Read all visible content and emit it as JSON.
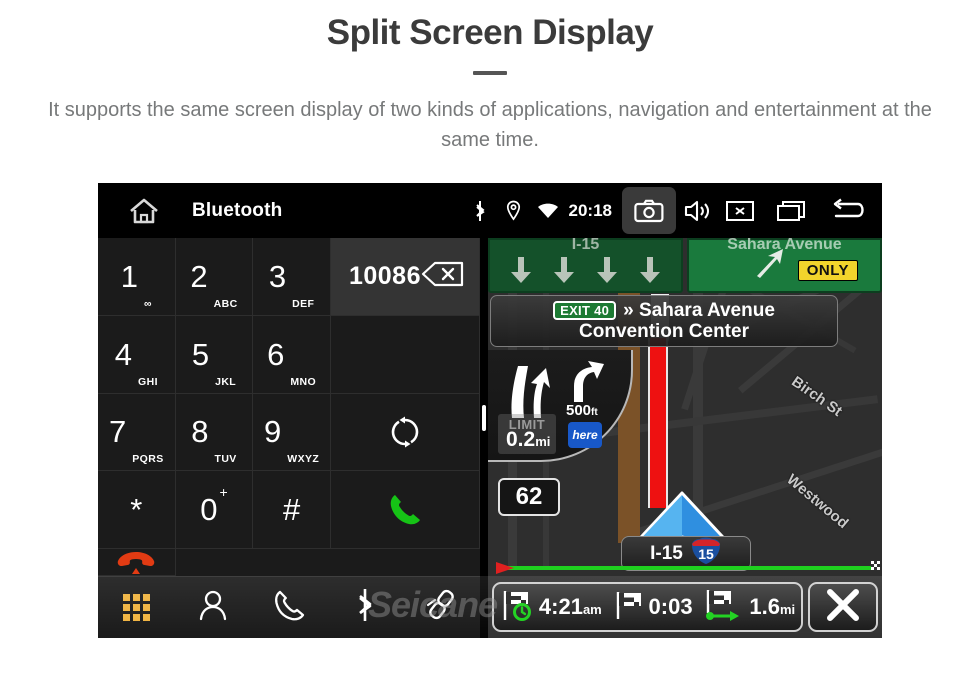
{
  "page": {
    "title": "Split Screen Display",
    "description": "It supports the same screen display of two kinds of applications, navigation and entertainment at the same time.",
    "watermark": "Seicane"
  },
  "statusbar": {
    "home_icon": "home-icon",
    "title": "Bluetooth",
    "bluetooth_icon": "bluetooth-icon",
    "location_icon": "location-pin-icon",
    "wifi_icon": "wifi-icon",
    "clock": "20:18",
    "camera_icon": "camera-icon",
    "volume_icon": "volume-icon",
    "close_icon": "close-box-icon",
    "recents_icon": "recents-icon",
    "back_icon": "back-arrow-icon"
  },
  "dialer": {
    "number": "10086",
    "backspace_icon": "backspace-icon",
    "keys": [
      {
        "digit": "1",
        "sub": "∞"
      },
      {
        "digit": "2",
        "sub": "ABC"
      },
      {
        "digit": "3",
        "sub": "DEF"
      },
      {
        "digit": "4",
        "sub": "GHI"
      },
      {
        "digit": "5",
        "sub": "JKL"
      },
      {
        "digit": "6",
        "sub": "MNO"
      },
      {
        "digit": "7",
        "sub": "PQRS"
      },
      {
        "digit": "8",
        "sub": "TUV"
      },
      {
        "digit": "9",
        "sub": "WXYZ"
      },
      {
        "digit": "*",
        "sub": ""
      },
      {
        "digit": "0",
        "sub": "+"
      },
      {
        "digit": "#",
        "sub": ""
      }
    ],
    "sync_icon": "sync-icon",
    "call_icon": "call-icon",
    "hangup_icon": "hangup-icon",
    "tabs": [
      {
        "name": "dialpad-tab",
        "icon": "dialpad-grid-icon",
        "active": true
      },
      {
        "name": "contacts-tab",
        "icon": "person-icon",
        "active": false
      },
      {
        "name": "call-history-tab",
        "icon": "phone-handset-icon",
        "active": false
      },
      {
        "name": "bluetooth-tab",
        "icon": "bluetooth-icon",
        "active": false
      },
      {
        "name": "pair-link-tab",
        "icon": "link-chain-icon",
        "active": false
      }
    ],
    "colors": {
      "active_tab": "#f0b23c",
      "call": "#16c316",
      "hangup": "#e23b13"
    }
  },
  "navigation": {
    "sign_left_text": "I-15",
    "sign_right_text": "Sahara Avenue",
    "only_badge": "ONLY",
    "exit_chip": "EXIT 40",
    "exit_name": "» Sahara Avenue",
    "exit_sub": "Convention Center",
    "maneuver_distance": "0.2",
    "maneuver_distance_unit": "mi",
    "speed_limit_label": "LIMIT",
    "next_distance": "500",
    "next_distance_unit": "ft",
    "provider_logo": "here",
    "current_speed": "62",
    "road_label": "I-15",
    "road_shield": "15",
    "streets": [
      {
        "name": "Birch St"
      },
      {
        "name": "Westwood"
      }
    ],
    "eta": [
      {
        "icon": "flag-clock-icon",
        "value": "4:21",
        "unit": "am"
      },
      {
        "icon": "flag-icon",
        "value": "0:03",
        "unit": ""
      },
      {
        "icon": "flag-arrow-icon",
        "value": "1.6",
        "unit": "mi"
      }
    ],
    "close_icon": "close-x-icon",
    "colors": {
      "route": "#ee1111",
      "progress": "#1fd01f",
      "sign": "#1a7a3d",
      "here": "#1858c8"
    }
  }
}
